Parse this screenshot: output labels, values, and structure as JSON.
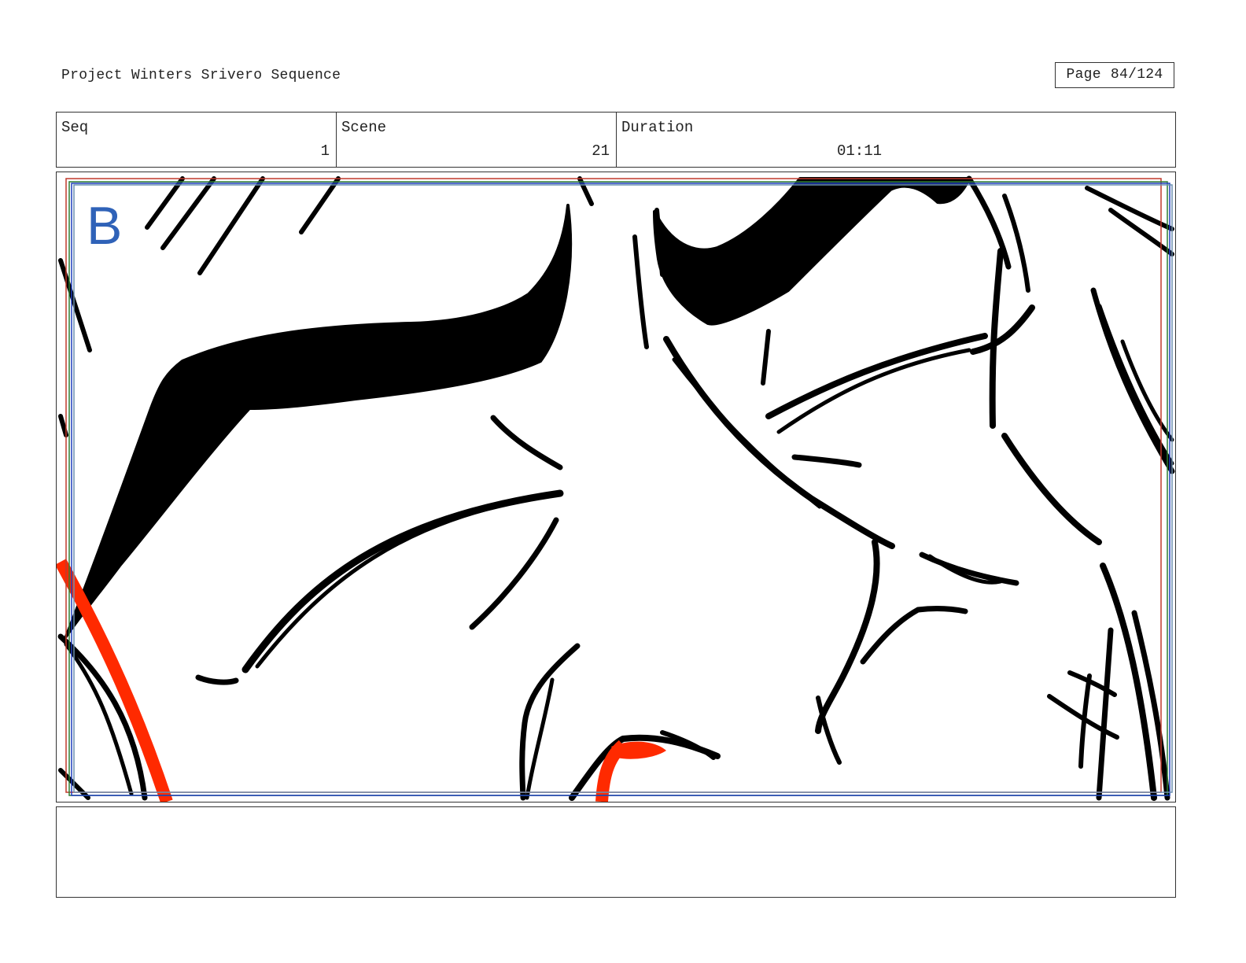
{
  "header": {
    "project_title": "Project Winters Srivero Sequence",
    "page_label": "Page",
    "page_number": "84/124"
  },
  "info": {
    "seq_label": "Seq",
    "seq_value": "1",
    "scene_label": "Scene",
    "scene_value": "21",
    "duration_label": "Duration",
    "duration_value": "01:11"
  },
  "panel": {
    "letter": "B",
    "letter_color": "#2f62b8",
    "accent_color": "#ff2a00",
    "guide_colors": [
      "#c0392b",
      "#2e7d32",
      "#1f3fbf",
      "#6a8fb0"
    ]
  },
  "notes": {
    "text": ""
  }
}
